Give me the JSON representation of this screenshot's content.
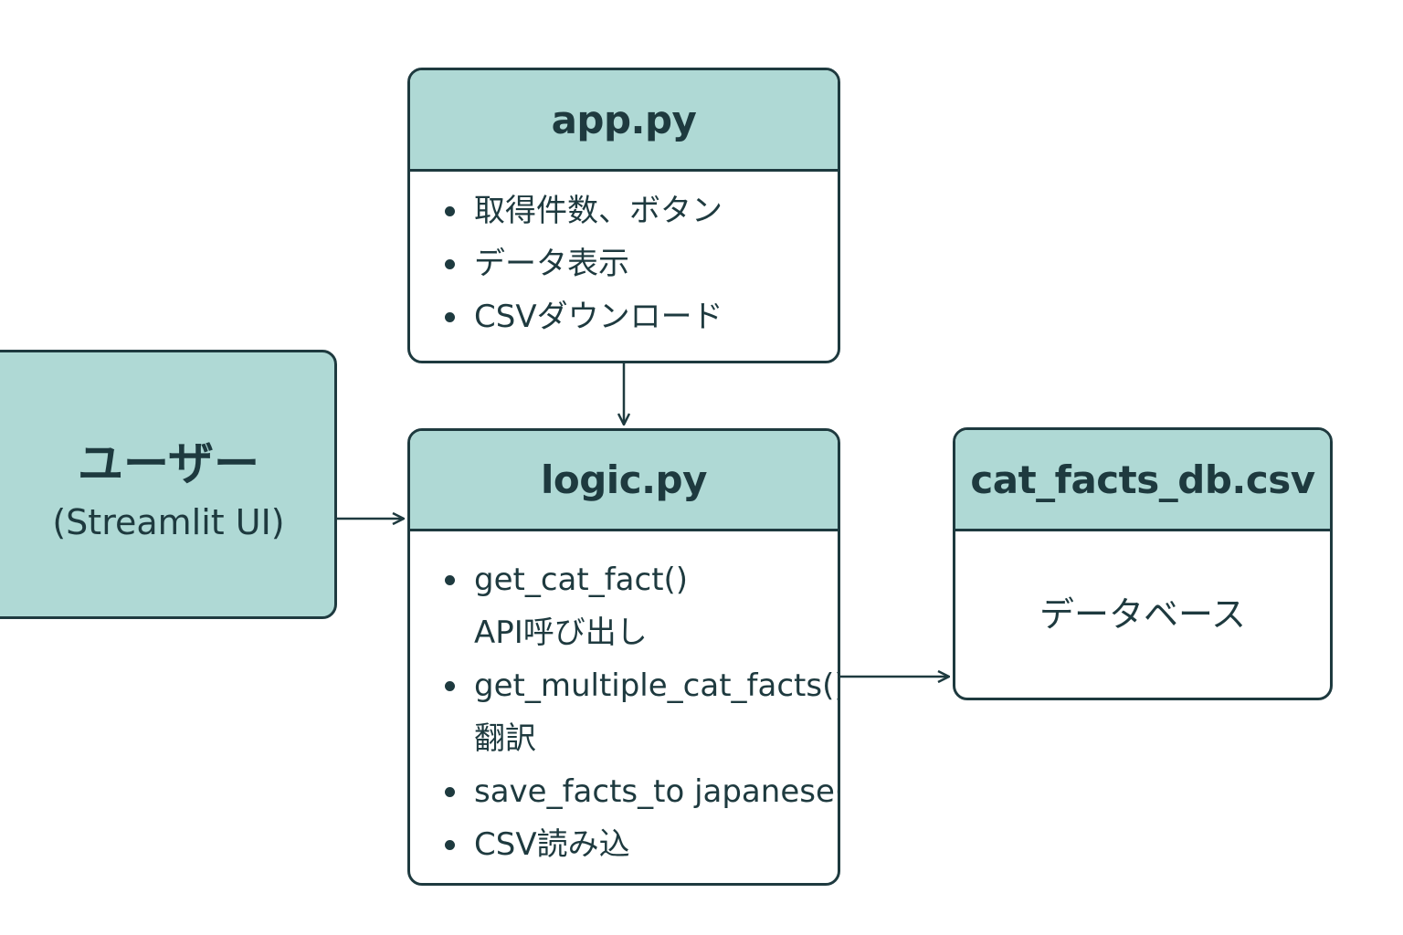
{
  "user": {
    "title": "ユーザー",
    "subtitle": "(Streamlit UI)"
  },
  "app": {
    "title": "app.py",
    "items": [
      "取得件数、ボタン",
      "データ表示",
      "CSVダウンロード"
    ]
  },
  "logic": {
    "title": "logic.py",
    "items": [
      {
        "text": "get_cat_fact()",
        "sub": "API呼び出し"
      },
      {
        "text": "get_multiple_cat_facts()",
        "sub": "翻訳"
      },
      {
        "text": "save_facts_to japanese()",
        "sub": ""
      },
      {
        "text": "CSV読み込",
        "sub": ""
      }
    ]
  },
  "db": {
    "title": "cat_facts_db.csv",
    "body": "データベース"
  },
  "colors": {
    "header_fill": "#afd9d5",
    "stroke": "#1e3a3f"
  }
}
